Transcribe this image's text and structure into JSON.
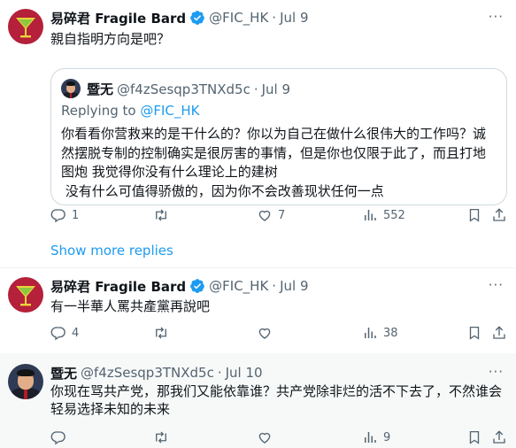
{
  "tweet1": {
    "name": "易碎君 Fragile Bard",
    "handle": "@FIC_HK",
    "dot": "·",
    "date": "Jul 9",
    "text": "親自指明方向是吧？",
    "quote": {
      "name": "暨无",
      "handle": "@f4zSesqp3TNXd5c",
      "dot": "·",
      "date": "Jul 9",
      "replying_prefix": "Replying to ",
      "replying_to": "@FIC_HK",
      "lines": [
        "你看看你营救来的是干什么的？你以为自己在做什么很伟大的工作吗？诚",
        "然摆脱专制的控制确实是很厉害的事情，但是你也仅限于此了，而且打地",
        "图炮 我觉得你没有什么理论上的建树",
        " 没有什么可值得骄傲的，因为你不会改善现状任何一点"
      ]
    },
    "actions": {
      "replies": "1",
      "retweets": "",
      "likes": "7",
      "views": "552"
    }
  },
  "show_more_replies": "Show more replies",
  "tweet2": {
    "name": "易碎君 Fragile Bard",
    "handle": "@FIC_HK",
    "dot": "·",
    "date": "Jul 9",
    "text": "有一半華人罵共產黨再說吧",
    "actions": {
      "replies": "4",
      "retweets": "",
      "likes": "",
      "views": "38"
    }
  },
  "tweet3": {
    "name": "暨无",
    "handle": "@f4zSesqp3TNXd5c",
    "dot": "·",
    "date": "Jul 10",
    "lines": [
      "你现在骂共产党，那我们又能依靠谁？共产党除非烂的活不下去了，不然谁会",
      "轻易选择未知的未来"
    ],
    "actions": {
      "replies": "",
      "retweets": "",
      "likes": "",
      "views": "9"
    }
  },
  "more_label": "···",
  "icons": {
    "verified": "verified-badge-icon",
    "reply": "reply-icon",
    "retweet": "retweet-icon",
    "like": "like-icon",
    "views": "views-icon",
    "bookmark": "bookmark-icon",
    "share": "share-icon"
  },
  "colors": {
    "accent": "#1d9bf0",
    "secondary_text": "#536471",
    "avatar_red": "#b5203a"
  }
}
